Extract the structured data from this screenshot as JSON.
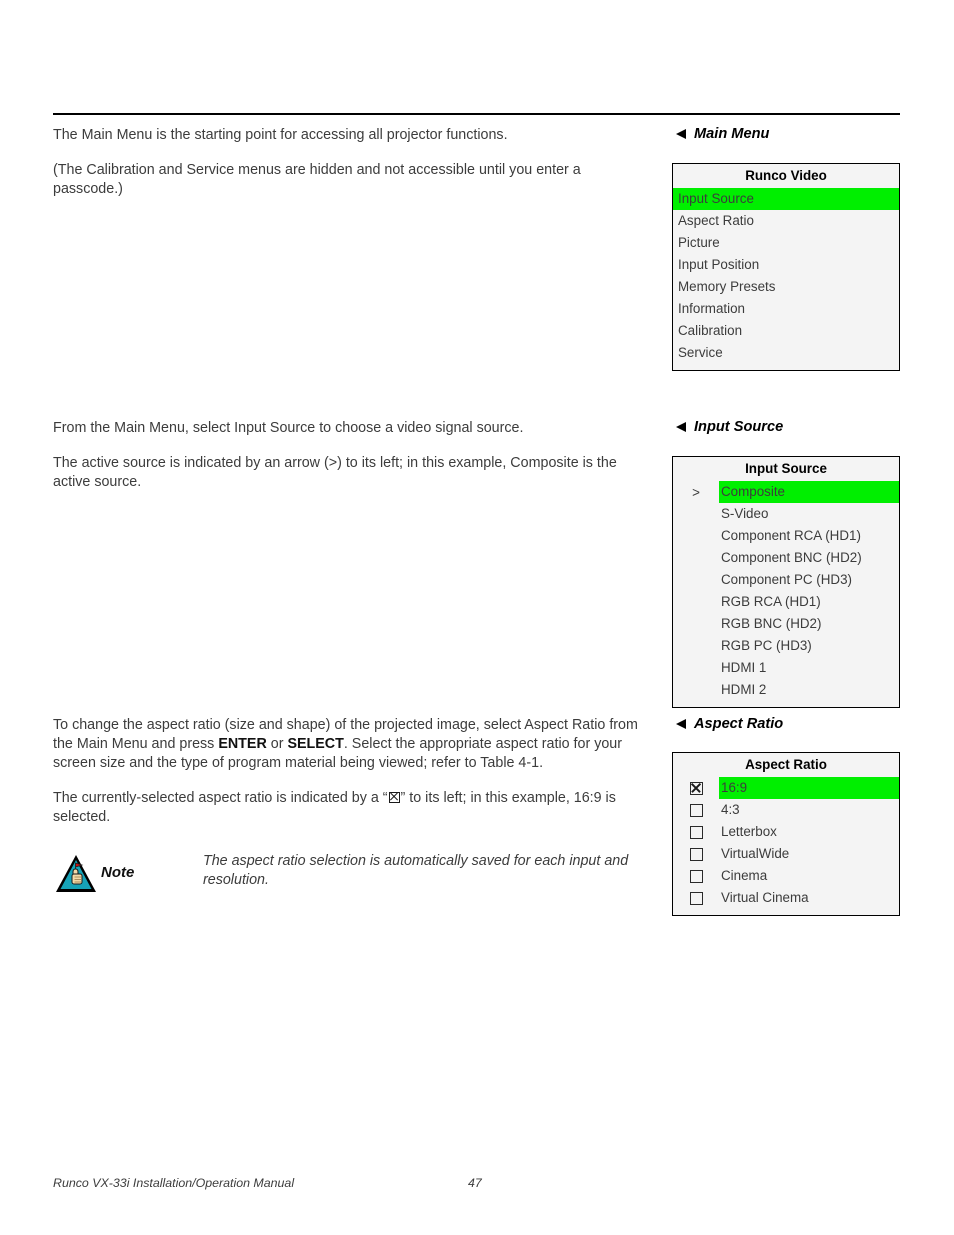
{
  "document": {
    "footer_title": "Runco VX-33i Installation/Operation Manual",
    "footer_page": "47"
  },
  "sections": {
    "main_menu": {
      "heading": "Main Menu",
      "paragraphs": [
        "The Main Menu is the starting point for accessing all projector functions.",
        "(The Calibration and Service menus are hidden and not accessible until you enter a passcode.)"
      ],
      "osd": {
        "title": "Runco Video",
        "highlight_color": "#00ef00",
        "items": [
          {
            "label": "Input Source",
            "selected": true
          },
          {
            "label": "Aspect Ratio",
            "selected": false
          },
          {
            "label": "Picture",
            "selected": false
          },
          {
            "label": "Input Position",
            "selected": false
          },
          {
            "label": "Memory Presets",
            "selected": false
          },
          {
            "label": "Information",
            "selected": false
          },
          {
            "label": "Calibration",
            "selected": false
          },
          {
            "label": "Service",
            "selected": false
          }
        ]
      }
    },
    "input_source": {
      "heading": "Input Source",
      "paragraphs": [
        "From the Main Menu, select Input Source to choose a video signal source.",
        "The active source is indicated by an arrow (>) to its left; in this example, Composite is the active source."
      ],
      "osd": {
        "title": "Input Source",
        "active_marker": ">",
        "highlight_color": "#00ef00",
        "items": [
          {
            "label": "Composite",
            "selected": true,
            "marker": ">"
          },
          {
            "label": "S-Video",
            "selected": false,
            "marker": ""
          },
          {
            "label": "Component RCA (HD1)",
            "selected": false,
            "marker": ""
          },
          {
            "label": "Component BNC (HD2)",
            "selected": false,
            "marker": ""
          },
          {
            "label": "Component PC (HD3)",
            "selected": false,
            "marker": ""
          },
          {
            "label": "RGB RCA (HD1)",
            "selected": false,
            "marker": ""
          },
          {
            "label": "RGB BNC (HD2)",
            "selected": false,
            "marker": ""
          },
          {
            "label": "RGB PC (HD3)",
            "selected": false,
            "marker": ""
          },
          {
            "label": "HDMI 1",
            "selected": false,
            "marker": ""
          },
          {
            "label": "HDMI 2",
            "selected": false,
            "marker": ""
          }
        ]
      }
    },
    "aspect_ratio": {
      "heading": "Aspect Ratio",
      "paragraph_1_a": "To change the aspect ratio (size and shape) of the projected image, select Aspect Ratio from the Main Menu and press ",
      "paragraph_1_b": "ENTER",
      "paragraph_1_c": " or ",
      "paragraph_1_d": "SELECT",
      "paragraph_1_e": ". Select the appropriate aspect ratio for your screen size and the type of program material being viewed; refer to Table 4-1.",
      "paragraph_2_a": "The currently-selected aspect ratio is indicated by a “",
      "paragraph_2_b": "” to its left; in this example, 16:9 is selected.",
      "note": {
        "icon": "note-triangle-hand-icon",
        "label": "Note",
        "text": "The aspect ratio selection is automatically saved for each input and resolution."
      },
      "osd": {
        "title": "Aspect Ratio",
        "highlight_color": "#00ef00",
        "items": [
          {
            "label": "16:9",
            "checked": true
          },
          {
            "label": "4:3",
            "checked": false
          },
          {
            "label": "Letterbox",
            "checked": false
          },
          {
            "label": "VirtualWide",
            "checked": false
          },
          {
            "label": "Cinema",
            "checked": false
          },
          {
            "label": "Virtual Cinema",
            "checked": false
          }
        ]
      }
    }
  }
}
